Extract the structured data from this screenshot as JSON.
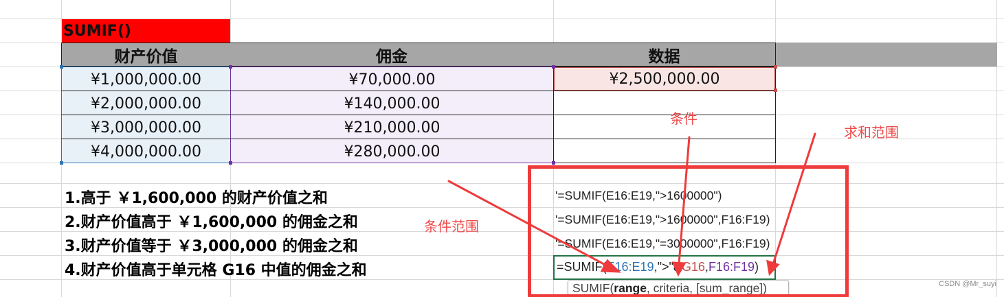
{
  "title_cell": "SUMIF()",
  "table": {
    "headers": [
      "财产价值",
      "佣金",
      "数据"
    ],
    "rows": [
      [
        "¥1,000,000.00",
        "¥70,000.00",
        "¥2,500,000.00"
      ],
      [
        "¥2,000,000.00",
        "¥140,000.00",
        ""
      ],
      [
        "¥3,000,000.00",
        "¥210,000.00",
        ""
      ],
      [
        "¥4,000,000.00",
        "¥280,000.00",
        ""
      ]
    ]
  },
  "questions": [
    "1.高于 ￥1,600,000 的财产价值之和",
    "2.财产价值高于 ￥1,600,000 的佣金之和",
    "3.财产价值等于 ￥3,000,000 的佣金之和",
    "4.财产价值高于单元格 G16 中值的佣金之和"
  ],
  "formulas": [
    "'=SUMIF(E16:E19,\">1600000\")",
    "'=SUMIF(E16:E19,\">1600000\",F16:F19)",
    "'=SUMIF(E16:E19,\"=3000000\",F16:F19)"
  ],
  "editing_formula": {
    "prefix": "=SUMIF(",
    "range_ref": "E16:E19",
    "sep1": ",",
    "criteria": "\">\"&",
    "cell_ref": "G16",
    "sep2": ",",
    "sum_ref": "F16:F19",
    "suffix": ")"
  },
  "tooltip": {
    "fn": "SUMIF(",
    "arg1": "range",
    "rest": ", criteria, [sum_range])"
  },
  "annotations": {
    "condition": "条件",
    "sum_range": "求和范围",
    "condition_range": "条件范围"
  },
  "watermark": "CSDN @Mr_suyi",
  "colors": {
    "title_fill": "#ff0000",
    "header_fill": "#a6a6a6",
    "range_blue": "#2f75b5",
    "range_purple": "#7030a0",
    "data_red": "#c0504d",
    "annotation_red": "#f04b4b",
    "frame_red": "#ee3b3b"
  }
}
